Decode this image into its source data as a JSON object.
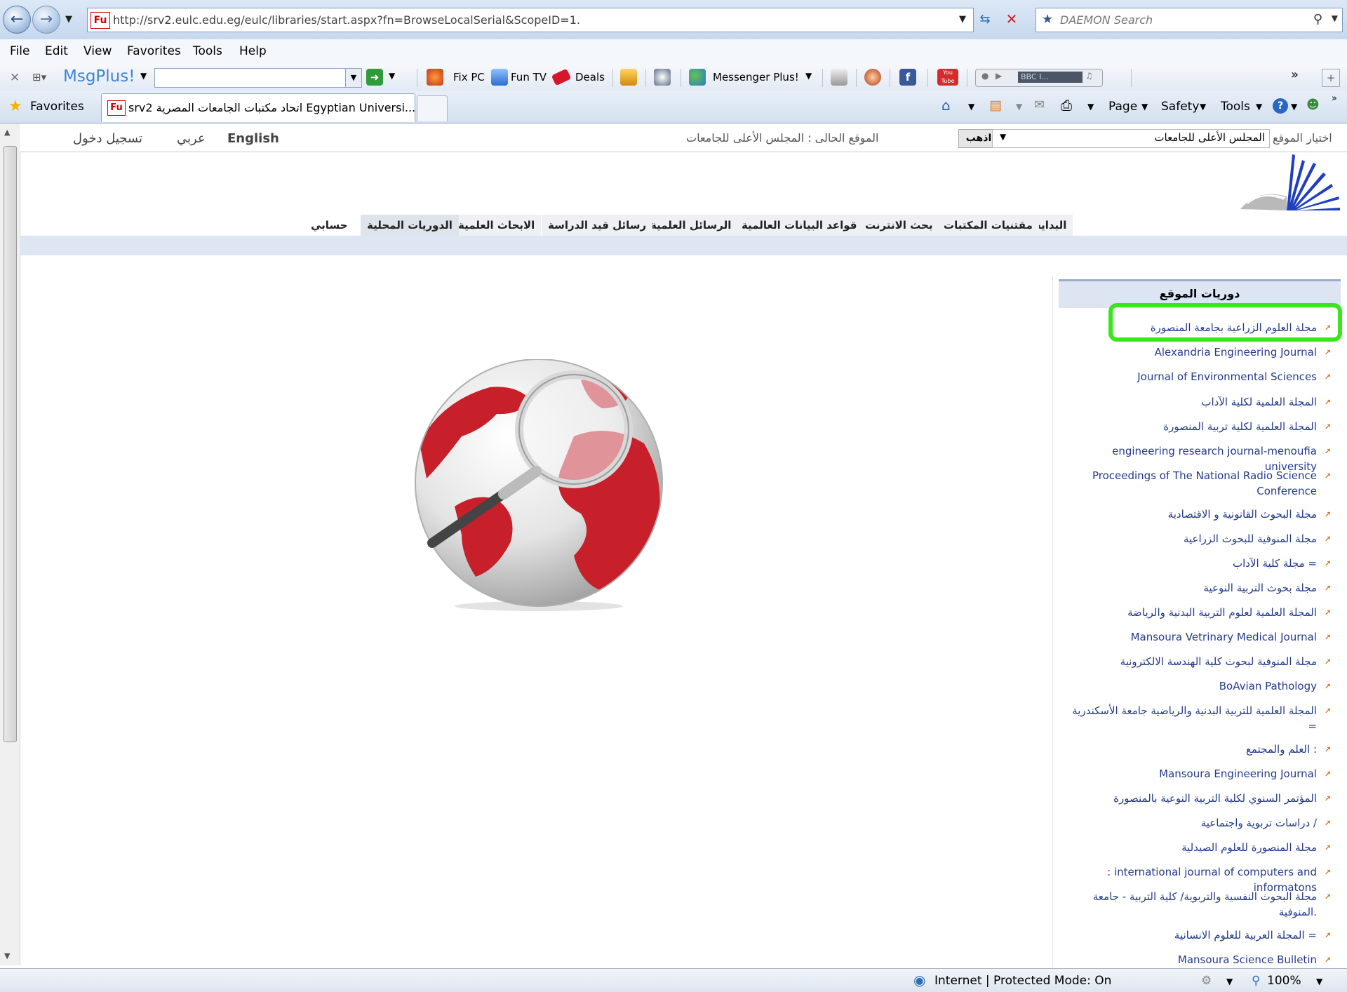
{
  "browser": {
    "url": "http://srv2.eulc.edu.eg/eulc/libraries/start.aspx?fn=BrowseLocalSerial&ScopeID=1.",
    "search_placeholder": "DAEMON Search",
    "favicon_label": "Fu",
    "menu": [
      "File",
      "Edit",
      "View",
      "Favorites",
      "Tools",
      "Help"
    ],
    "toolbar": {
      "msgplus": "MsgPlus!",
      "fix_pc": "Fix PC",
      "fun_tv": "Fun TV",
      "deals": "Deals",
      "messenger": "Messenger Plus!",
      "radio": "BBC I...",
      "youtube": "You Tube",
      "more": "»"
    },
    "favorites_label": "Favorites",
    "tab_title": "srv2 اتحاد مكتبات الجامعات المصرية Egyptian Universi...",
    "commands": {
      "page": "Page",
      "safety": "Safety",
      "tools": "Tools"
    },
    "status": {
      "zone": "Internet | Protected Mode: On",
      "zoom": "100%"
    }
  },
  "page": {
    "top": {
      "login": "تسجيل دخول",
      "arabic": "عربي",
      "english": "English",
      "current_site": "الموقع الحالى : المجلس الأعلى للجامعات",
      "go": "اذهب",
      "site_select_value": "المجلس الأعلى للجامعات",
      "choose_site": "اختيار الموقع"
    },
    "nav": [
      "البداية",
      "مقتنيات المكتبات",
      "بحث الانترنت",
      "قواعد البيانات العالمية",
      "الرسائل العلمية",
      "رسائل قيد الدراسة",
      "الابحاث العلمية",
      "الدوريات المحلية",
      "حسابي"
    ],
    "sidebar": {
      "title": "دوريات الموقع",
      "items": [
        "مجلة العلوم الزراعية بجامعة المنصورة",
        "Alexandria Engineering Journal",
        "Journal of Environmental Sciences",
        "المجلة العلمية لكلية الآداب",
        "المجلة العلمية لكلية تربية المنصورة",
        "engineering research journal-menoufia university",
        "Proceedings of The National Radio Science Conference",
        "مجلة البحوث القانونية و الاقتصادية",
        "مجلة المنوفية للبحوث الزراعية",
        "مجلة كلية الآداب =",
        "مجلة بحوث التربية النوعية",
        "المجلة العلمية لعلوم التربية البدنية والرياضة",
        "Mansoura Vetrinary Medical Journal",
        "مجلة المنوفية لبحوث كلية الهندسة الالكترونية",
        "BoAvian Pathology",
        "المجلة العلمية للتربية البدنية والرياضية جامعة الأسكندرية =",
        "العلم والمجتمع :",
        "Mansoura Engineering Journal",
        "المؤتمر السنوي لكلية التربية النوعية بالمنصورة",
        "دراسات تربوية واجتماعية /",
        "مجلة المنصورة للعلوم الصيدلية",
        ": international journal of computers and informatons",
        "مجلة البحوث النفسية والتربوية/ كلية التربية - جامعة المنوفية.",
        "المجلة العربية للعلوم الانسانية =",
        "Mansoura Science Bulletin"
      ]
    }
  },
  "colors": {
    "link": "#223a8a",
    "highlight": "#39e61a",
    "globe_red": "#c8202a"
  }
}
